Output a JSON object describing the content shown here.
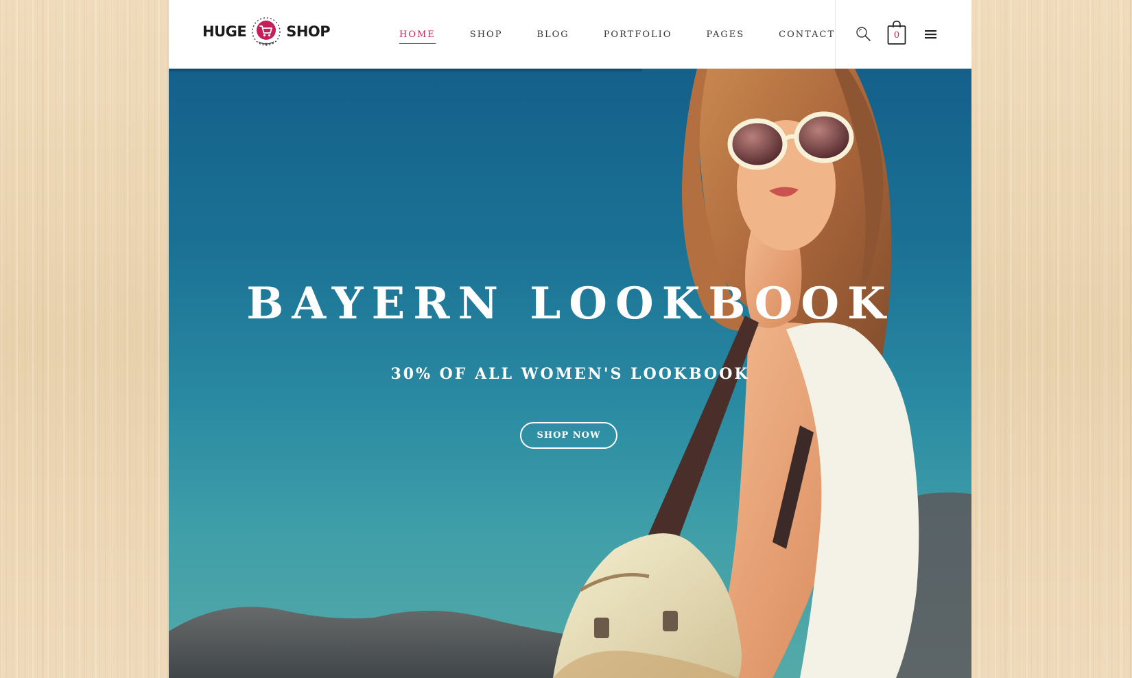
{
  "brand": {
    "name_left": "HUGE",
    "name_right": "SHOP"
  },
  "nav": {
    "items": [
      {
        "label": "HOME",
        "active": true
      },
      {
        "label": "SHOP",
        "active": false
      },
      {
        "label": "BLOG",
        "active": false
      },
      {
        "label": "PORTFOLIO",
        "active": false
      },
      {
        "label": "PAGES",
        "active": false
      },
      {
        "label": "CONTACT",
        "active": false
      }
    ]
  },
  "header_actions": {
    "search_icon": "search-icon",
    "cart_icon": "shopping-bag-icon",
    "cart_count": "0",
    "menu_icon": "hamburger-menu-icon"
  },
  "hero": {
    "title": "BAYERN LOOKBOOK",
    "subtitle": "30% OF ALL WOMEN'S LOOKBOOK",
    "cta_label": "SHOP NOW",
    "slide_progress": 0.59
  },
  "colors": {
    "accent": "#c41f5a",
    "sky_top": "#14608b",
    "sky_bottom": "#55aaa8",
    "background_wood": "#ecd7b5"
  }
}
